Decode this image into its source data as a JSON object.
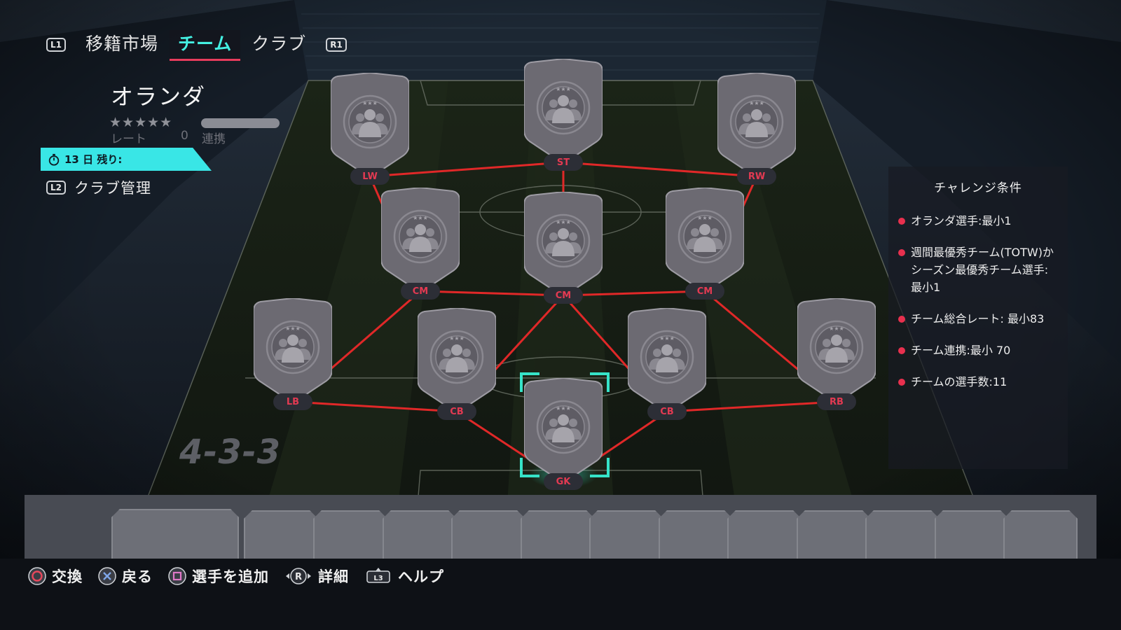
{
  "nav": {
    "left_button": "L1",
    "right_button": "R1",
    "tabs": [
      {
        "label": "移籍市場",
        "active": false
      },
      {
        "label": "チーム",
        "active": true
      },
      {
        "label": "クラブ",
        "active": false
      }
    ]
  },
  "squad": {
    "name": "オランダ",
    "stars": "★★★★★",
    "rating_label": "レート",
    "rating_value": "0",
    "chemistry_label": "連携",
    "timer_text": "13 日 残り:",
    "club_mgmt_button": "L2",
    "club_mgmt_label": "クラブ管理"
  },
  "formation": "4-3-3",
  "pitch": {
    "positions": [
      {
        "id": "lw",
        "label": "LW",
        "selected": false
      },
      {
        "id": "st",
        "label": "ST",
        "selected": false
      },
      {
        "id": "rw",
        "label": "RW",
        "selected": false
      },
      {
        "id": "lcm",
        "label": "CM",
        "selected": false
      },
      {
        "id": "cm",
        "label": "CM",
        "selected": false
      },
      {
        "id": "rcm",
        "label": "CM",
        "selected": false
      },
      {
        "id": "lb",
        "label": "LB",
        "selected": false
      },
      {
        "id": "lcb",
        "label": "CB",
        "selected": false
      },
      {
        "id": "rcb",
        "label": "CB",
        "selected": false
      },
      {
        "id": "rb",
        "label": "RB",
        "selected": false
      },
      {
        "id": "gk",
        "label": "GK",
        "selected": true
      }
    ],
    "links": [
      [
        "lw",
        "st"
      ],
      [
        "st",
        "rw"
      ],
      [
        "st",
        "cm"
      ],
      [
        "lw",
        "lcm"
      ],
      [
        "rw",
        "rcm"
      ],
      [
        "lcm",
        "cm"
      ],
      [
        "cm",
        "rcm"
      ],
      [
        "lcm",
        "lb"
      ],
      [
        "cm",
        "lcb"
      ],
      [
        "cm",
        "rcb"
      ],
      [
        "rcm",
        "rb"
      ],
      [
        "lb",
        "lcb"
      ],
      [
        "lcb",
        "gk"
      ],
      [
        "gk",
        "rcb"
      ],
      [
        "rcb",
        "rb"
      ]
    ]
  },
  "challenge": {
    "title": "チャレンジ条件",
    "items": [
      "オランダ選手:最小1",
      "週間最優秀チーム(TOTW)か シーズン最優秀チーム選手:最小1",
      "チーム総合レート: 最小83",
      "チーム連携:最小 70",
      "チームの選手数:11"
    ]
  },
  "bench": {
    "slot_count": 13
  },
  "hints": [
    {
      "icon": "circle-button-icon",
      "label": "交換"
    },
    {
      "icon": "cross-button-icon",
      "label": "戻る"
    },
    {
      "icon": "square-button-icon",
      "label": "選手を追加"
    },
    {
      "icon": "right-stick-icon",
      "label": "詳細"
    },
    {
      "icon": "touchpad-l3-icon",
      "label": "ヘルプ"
    }
  ],
  "colors": {
    "accent_cyan": "#39e6e6",
    "link_red": "#e02828",
    "position_red": "#e33a52",
    "selection_teal": "#36e3c8",
    "card_gray": "#6c6a72"
  }
}
